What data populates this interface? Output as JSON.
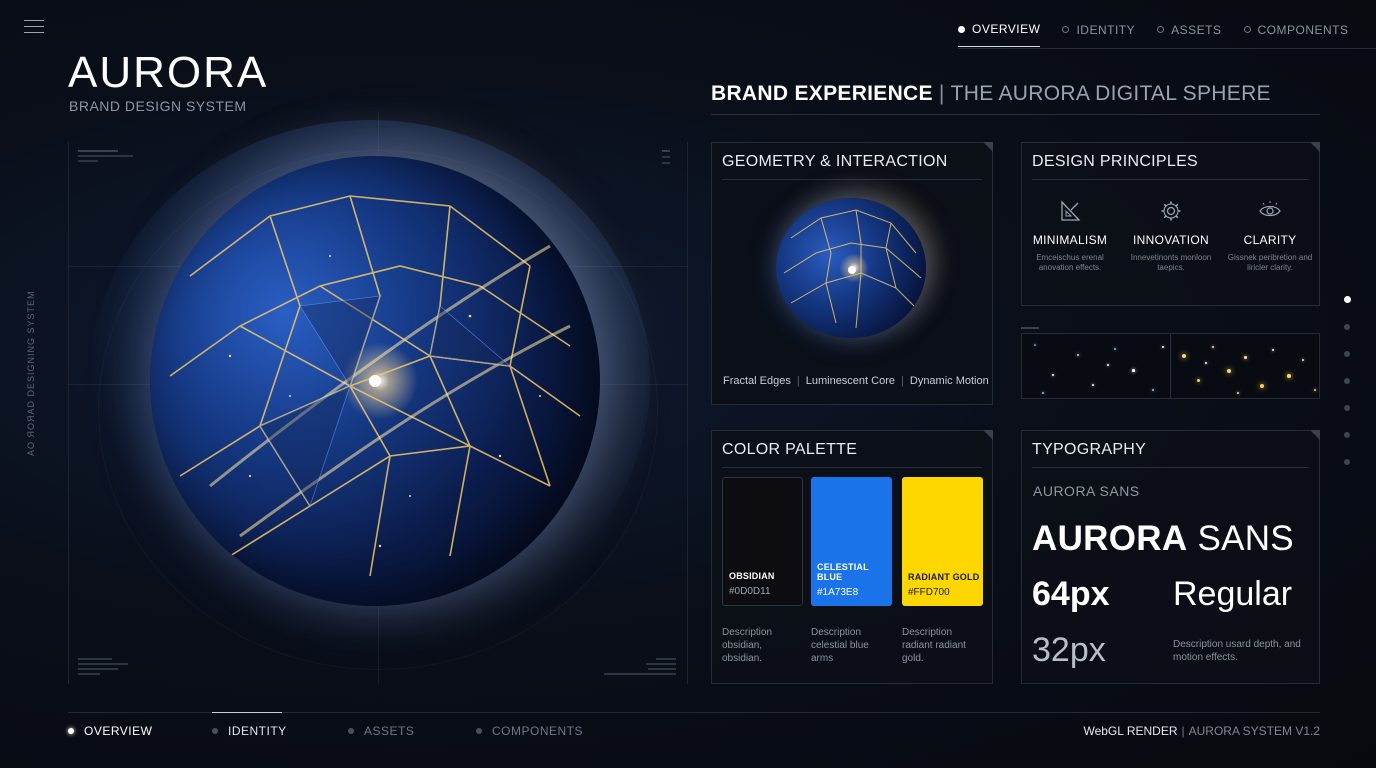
{
  "logo": {
    "text": "AURORA",
    "subtitle": "BRAND DESIGN SYSTEM"
  },
  "top_nav": [
    {
      "label": "OVERVIEW",
      "active": true
    },
    {
      "label": "IDENTITY",
      "active": false
    },
    {
      "label": "ASSETS",
      "active": false
    },
    {
      "label": "COMPONENTS",
      "active": false
    }
  ],
  "side_text": "AO ЯOЯAD DESIGNING SYSTEM",
  "header": {
    "strong": "BRAND EXPERIENCE",
    "separator": "|",
    "light": "THE AURORA DIGITAL SPHERE"
  },
  "geometry": {
    "title": "GEOMETRY & INTERACTION",
    "features": [
      "Fractal Edges",
      "Luminescent Core",
      "Dynamic Motion"
    ]
  },
  "principles": {
    "title": "DESIGN PRINCIPLES",
    "items": [
      {
        "name": "MINIMALISM",
        "desc": "Emceischus erenal anovation effects.",
        "icon": "ruler-triangle-icon"
      },
      {
        "name": "INNOVATION",
        "desc": "Innevetinonts monloon taepics.",
        "icon": "gear-icon"
      },
      {
        "name": "CLARITY",
        "desc": "Gissnek peribretion and liricler clarity.",
        "icon": "eye-icon"
      }
    ]
  },
  "palette": {
    "title": "COLOR PALETTE",
    "swatches": [
      {
        "name": "OBSIDIAN",
        "hex": "#0D0D11",
        "desc": "Description obsidian, obsidian.",
        "color": "#0D0D11",
        "text_color": "#ffffff"
      },
      {
        "name": "CELESTIAL BLUE",
        "hex": "#1A73E8",
        "desc": "Description celestial blue arms",
        "color": "#1A73E8",
        "text_color": "#ffffff"
      },
      {
        "name": "RADIANT GOLD",
        "hex": "#FFD700",
        "desc": "Description radiant radiant gold.",
        "color": "#FFD700",
        "text_color": "#1a1a1a"
      }
    ]
  },
  "typography": {
    "title": "TYPOGRAPHY",
    "font_name_small": "AURORA SANS",
    "font_name_bold": "AURORA",
    "font_name_regular": "SANS",
    "size_large": "64px",
    "weight": "Regular",
    "size_small": "32px",
    "desc": "Description usard depth, and motion effects."
  },
  "pager": {
    "count": 7,
    "active_index": 0
  },
  "bottom_nav": [
    {
      "label": "OVERVIEW",
      "state": "active"
    },
    {
      "label": "IDENTITY",
      "state": "current"
    },
    {
      "label": "ASSETS",
      "state": "normal"
    },
    {
      "label": "COMPONENTS",
      "state": "normal"
    }
  ],
  "footer": {
    "left": "WebGL RENDER",
    "separator": "|",
    "right": "AURORA SYSTEM V1.2"
  },
  "colors": {
    "accent_blue": "#1A73E8",
    "accent_gold": "#FFD700",
    "background": "#0a0f1a"
  }
}
